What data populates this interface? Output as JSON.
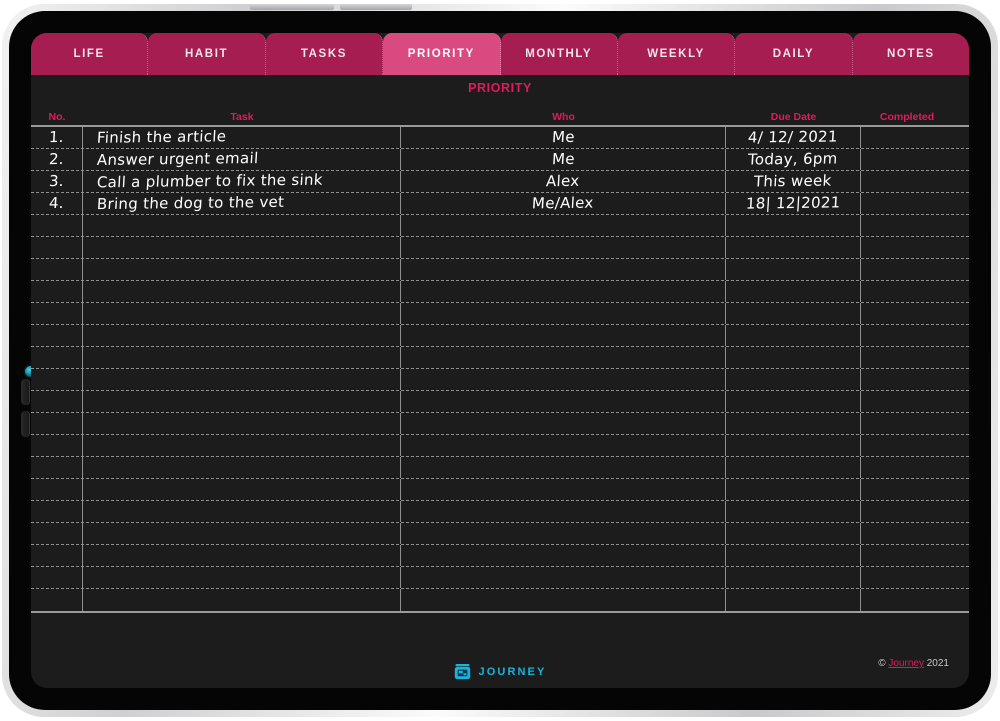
{
  "device": {
    "type": "tablet",
    "sensor_icon": "camera-sensor-icon",
    "buttons": [
      "volume-up-button",
      "volume-down-button",
      "power-button"
    ]
  },
  "tabs": [
    {
      "label": "LIFE",
      "active": false
    },
    {
      "label": "HABIT",
      "active": false
    },
    {
      "label": "TASKS",
      "active": false
    },
    {
      "label": "PRIORITY",
      "active": true
    },
    {
      "label": "MONTHLY",
      "active": false
    },
    {
      "label": "WEEKLY",
      "active": false
    },
    {
      "label": "DAILY",
      "active": false
    },
    {
      "label": "NOTES",
      "active": false
    }
  ],
  "page": {
    "title": "PRIORITY"
  },
  "table": {
    "columns": [
      "No.",
      "Task",
      "Who",
      "Due Date",
      "Completed"
    ],
    "total_rows": 22,
    "rows": [
      {
        "no": "1.",
        "task": "Finish the article",
        "who": "Me",
        "due": "4/ 12/ 2021",
        "completed": ""
      },
      {
        "no": "2.",
        "task": "Answer urgent email",
        "who": "Me",
        "due": "Today, 6pm",
        "completed": ""
      },
      {
        "no": "3.",
        "task": "Call a plumber to fix the sink",
        "who": "Alex",
        "due": "This week",
        "completed": ""
      },
      {
        "no": "4.",
        "task": "Bring the dog to the vet",
        "who": "Me/Alex",
        "due": "18| 12|2021",
        "completed": ""
      }
    ]
  },
  "footer": {
    "brand_icon": "journey-app-icon",
    "brand_name": "JOURNEY",
    "copyright_symbol": "©",
    "copyright_link": "Journey",
    "copyright_year": "2021"
  },
  "colors": {
    "tab_inactive": "#a61d52",
    "tab_active": "#d94a80",
    "accent_pink": "#e01b5c",
    "brand_cyan": "#17b4e0",
    "screen_bg": "#1c1c1c",
    "grid_line": "#8f8f8f",
    "handwriting": "#ffffff"
  }
}
